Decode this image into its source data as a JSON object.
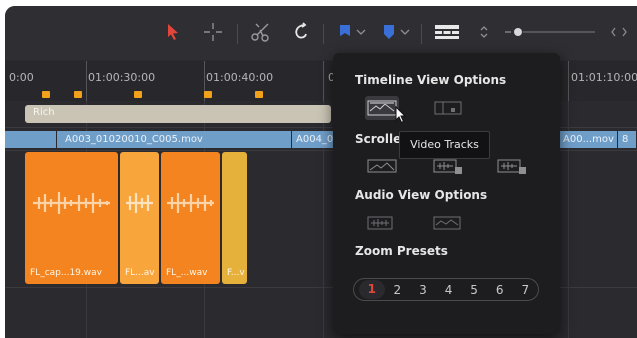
{
  "toolbar": {
    "icons": [
      "pointer-arrow-icon",
      "crosshair-icon",
      "scissors-icon",
      "snap-hook-icon",
      "blue-flag-icon",
      "blue-marker-icon",
      "timeline-view-options-icon",
      "expand-chevrons-icon",
      "zoom-slider",
      "zoom-range-icon"
    ],
    "colors": {
      "pointer": "#e2453a",
      "flag": "#3b6fd8"
    }
  },
  "ruler": {
    "labels": [
      "0:00",
      "01:00:30:00",
      "01:00:40:00",
      "0",
      "01:01:10:00"
    ]
  },
  "timeline": {
    "title_clip": "Rich",
    "video_clips": [
      "A003_01020010_C005.mov",
      "A004_0",
      "A00...mov",
      "8"
    ],
    "audio_clips": [
      "FL_cap...19.wav",
      "FL...av",
      "FL_...wav",
      "F...v"
    ],
    "colors": {
      "audio_dark": "#f4841f",
      "audio_light": "#f8a53c",
      "audio_yellow": "#e6b13a",
      "video": "#6f9ec9",
      "title": "#c9c4b4",
      "marker": "#f2a21a"
    }
  },
  "popup": {
    "timeline_view_options": "Timeline View Options",
    "scroller": "Scroller",
    "audio_view_options": "Audio View Options",
    "zoom_presets": "Zoom Presets",
    "tooltip": "Video Tracks",
    "zoom_numbers": [
      "1",
      "2",
      "3",
      "4",
      "5",
      "6",
      "7"
    ],
    "active_zoom": "1"
  }
}
